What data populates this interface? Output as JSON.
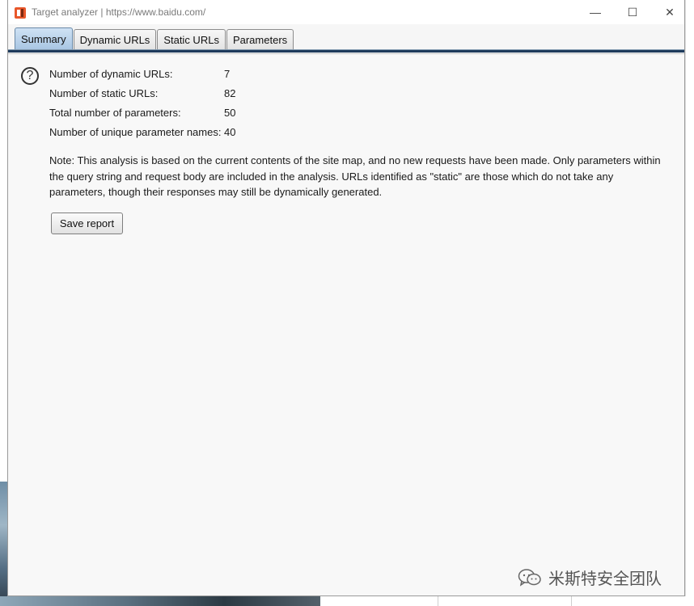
{
  "window": {
    "title": "Target analyzer | https://www.baidu.com/",
    "minimize_symbol": "—",
    "maximize_symbol": "☐",
    "close_symbol": "✕"
  },
  "tabs": [
    {
      "label": "Summary",
      "active": true
    },
    {
      "label": "Dynamic URLs",
      "active": false
    },
    {
      "label": "Static URLs",
      "active": false
    },
    {
      "label": "Parameters",
      "active": false
    }
  ],
  "summary": {
    "help_symbol": "?",
    "stats": [
      {
        "label": "Number of dynamic URLs:",
        "value": "7"
      },
      {
        "label": "Number of static URLs:",
        "value": "82"
      },
      {
        "label": "Total number of parameters:",
        "value": "50"
      },
      {
        "label": "Number of unique parameter names:",
        "value": "40"
      }
    ],
    "note": "Note: This analysis is based on the current contents of the site map, and no new requests have been made. Only parameters within the query string and request body are included in the analysis. URLs identified as \"static\" are those which do not take any parameters, though their responses may still be dynamically generated.",
    "save_button": "Save report"
  },
  "watermark": {
    "text": "米斯特安全团队",
    "icon": "wechat-icon"
  },
  "colors": {
    "active_tab": "#a9c6e3",
    "tab_divider": "#1f3b5c",
    "panel_bg": "#f8f8f8"
  }
}
